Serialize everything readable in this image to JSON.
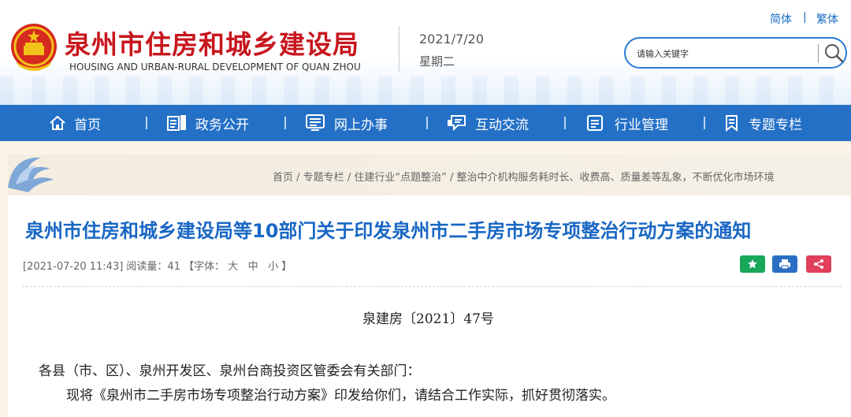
{
  "header": {
    "title": "泉州市住房和城乡建设局",
    "subtitle": "HOUSING AND URBAN-RURAL DEVELOPMENT OF QUAN ZHOU",
    "date": "2021/7/20",
    "weekday": "星期二",
    "lang_simplified": "简体",
    "lang_separator": "|",
    "lang_traditional": "繁体",
    "search_placeholder": "请输入关键字",
    "title_color": "#c8161d"
  },
  "nav": {
    "color": "#2470c6",
    "items": [
      {
        "label": "首页",
        "icon": "home-icon"
      },
      {
        "label": "政务公开",
        "icon": "document-icon"
      },
      {
        "label": "网上办事",
        "icon": "list-icon"
      },
      {
        "label": "互动交流",
        "icon": "chat-icon"
      },
      {
        "label": "行业管理",
        "icon": "clipboard-icon"
      },
      {
        "label": "专题专栏",
        "icon": "bookmark-icon"
      }
    ]
  },
  "breadcrumb": {
    "items": [
      "首页",
      "专题专栏",
      "住建行业“点题整治”",
      "整治中介机构服务耗时长、收费高、质量差等乱象，不断优化市场环境"
    ],
    "separator": " / "
  },
  "article": {
    "title": "泉州市住房和城乡建设局等10部门关于印发泉州市二手房市场专项整治行动方案的通知",
    "meta_prefix": "[2021-07-20 11:43] 阅读量：41 【字体：",
    "font_large": "大",
    "font_medium": "中",
    "font_small": "小",
    "meta_suffix": "】",
    "doc_number": "泉建房〔2021〕47号",
    "paragraph_1": "各县（市、区）、泉州开发区、泉州台商投资区管委会有关部门：",
    "paragraph_2": "现将《泉州市二手房市场专项整治行动方案》印发给你们，请结合工作实际，抓好贯彻落实。",
    "title_color": "#1967c4"
  },
  "tools": {
    "favorite_icon": "star-icon",
    "print_icon": "print-icon",
    "share_icon": "share-icon",
    "favorite_color": "#18a85a",
    "print_color": "#2b6fc4",
    "share_color": "#e0405a"
  }
}
